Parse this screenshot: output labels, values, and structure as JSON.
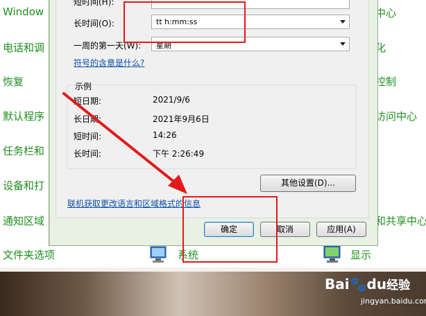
{
  "control_panel": {
    "left_items": [
      "Window",
      "电话和调",
      "恢复",
      "默认程序",
      "任务栏和",
      "设备和打",
      "通知区域",
      "文件夹选项"
    ],
    "right_items": [
      "中心",
      "化",
      "控制",
      "访问中心",
      "",
      "",
      "和共享中心"
    ],
    "bottom_items": [
      "系统",
      "显示"
    ]
  },
  "dialog": {
    "short_time_label": "短时间(H):",
    "long_time_label": "长时间(O):",
    "long_time_value": "tt h:mm:ss",
    "first_day_label": "一周的第一天(W):",
    "first_day_value": "星期",
    "symbols_link": "符号的含意是什么?",
    "examples": {
      "title": "示例",
      "rows": [
        {
          "label": "短日期:",
          "value": "2021/9/6"
        },
        {
          "label": "长日期:",
          "value": "2021年9月6日"
        },
        {
          "label": "短时间:",
          "value": "14:26"
        },
        {
          "label": "长时间:",
          "value": "下午 2:26:49"
        }
      ]
    },
    "other_settings_button": "其他设置(D)...",
    "online_link": "联机获取更改语言和区域格式的信息",
    "ok_button": "确定",
    "cancel_button": "取消",
    "apply_button": "应用(A)"
  },
  "watermark": {
    "brand": "Bai",
    "brand2": "du",
    "suffix": "经验",
    "url": "jingyan.baidu.com"
  },
  "colors": {
    "annotation_red": "#e21a1a",
    "control_panel_green": "#1e8f1e",
    "link_blue": "#0e4fa8"
  }
}
